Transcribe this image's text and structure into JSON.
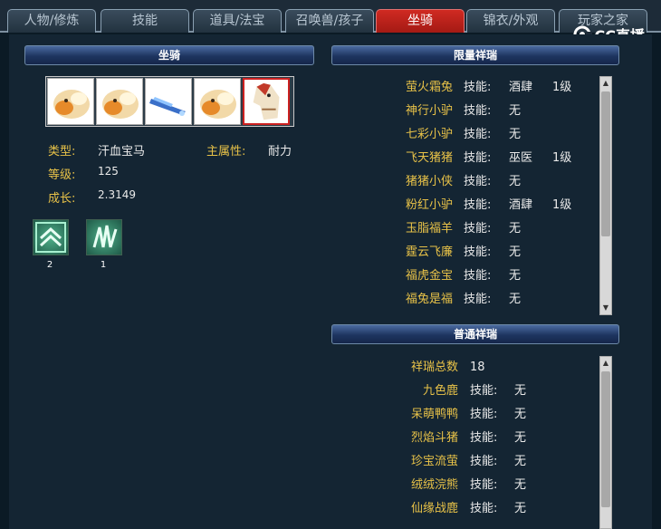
{
  "tabs": [
    {
      "label": "人物/修炼",
      "active": false
    },
    {
      "label": "技能",
      "active": false
    },
    {
      "label": "道具/法宝",
      "active": false
    },
    {
      "label": "召唤兽/孩子",
      "active": false
    },
    {
      "label": "坐骑",
      "active": true
    },
    {
      "label": "锦衣/外观",
      "active": false
    },
    {
      "label": "玩家之家",
      "active": false
    }
  ],
  "watermark": "CC直播",
  "mount_panel": {
    "header": "坐骑",
    "type_label": "类型:",
    "type_value": "汗血宝马",
    "attr_label": "主属性:",
    "attr_value": "耐力",
    "level_label": "等级:",
    "level_value": "125",
    "growth_label": "成长:",
    "growth_value": "2.3149",
    "skills": [
      {
        "icon": "mount-skill-icon",
        "count": "2"
      },
      {
        "icon": "mount-skill-icon",
        "count": "1"
      }
    ]
  },
  "limited_panel": {
    "header": "限量祥瑞",
    "rows": [
      {
        "name": "萤火霜兔",
        "skill": "技能:",
        "value": "酒肆",
        "level": "1级"
      },
      {
        "name": "神行小驴",
        "skill": "技能:",
        "value": "无",
        "level": ""
      },
      {
        "name": "七彩小驴",
        "skill": "技能:",
        "value": "无",
        "level": ""
      },
      {
        "name": "飞天猪猪",
        "skill": "技能:",
        "value": "巫医",
        "level": "1级"
      },
      {
        "name": "猪猪小侠",
        "skill": "技能:",
        "value": "无",
        "level": ""
      },
      {
        "name": "粉红小驴",
        "skill": "技能:",
        "value": "酒肆",
        "level": "1级"
      },
      {
        "name": "玉脂福羊",
        "skill": "技能:",
        "value": "无",
        "level": ""
      },
      {
        "name": "霆云飞廉",
        "skill": "技能:",
        "value": "无",
        "level": ""
      },
      {
        "name": "福虎金宝",
        "skill": "技能:",
        "value": "无",
        "level": ""
      },
      {
        "name": "福兔是福",
        "skill": "技能:",
        "value": "无",
        "level": ""
      }
    ]
  },
  "normal_panel": {
    "header": "普通祥瑞",
    "total_label": "祥瑞总数",
    "total_value": "18",
    "rows": [
      {
        "name": "九色鹿",
        "skill": "技能:",
        "value": "无"
      },
      {
        "name": "呆萌鸭鸭",
        "skill": "技能:",
        "value": "无"
      },
      {
        "name": "烈焰斗猪",
        "skill": "技能:",
        "value": "无"
      },
      {
        "name": "珍宝流萤",
        "skill": "技能:",
        "value": "无"
      },
      {
        "name": "绒绒浣熊",
        "skill": "技能:",
        "value": "无"
      },
      {
        "name": "仙缘战鹿",
        "skill": "技能:",
        "value": "无"
      }
    ]
  }
}
